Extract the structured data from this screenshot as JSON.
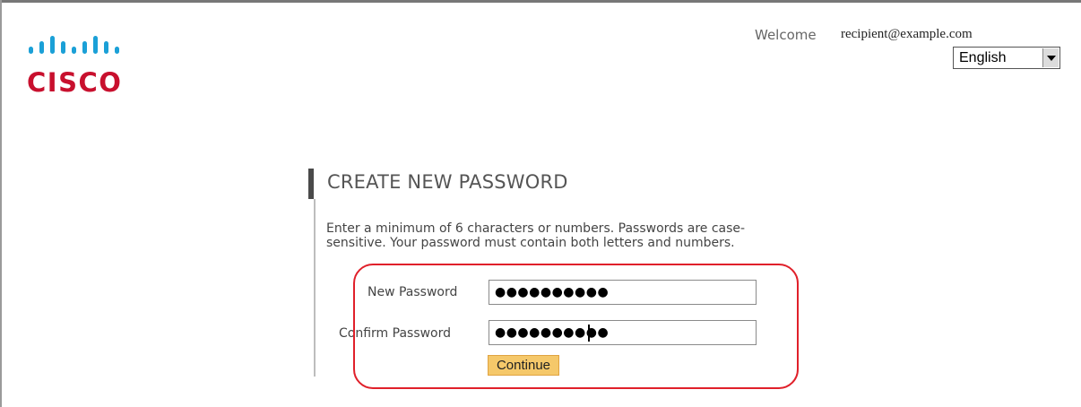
{
  "header": {
    "welcome_label": "Welcome",
    "user_email": "recipient@example.com",
    "language": {
      "selected": "English"
    },
    "logo": {
      "name": "cisco-logo",
      "text": "CISCO",
      "bar_color": "#1ba0d7",
      "text_color": "#c8102e"
    }
  },
  "form": {
    "title": "CREATE NEW PASSWORD",
    "instructions": "Enter a minimum of 6 characters or numbers. Passwords are case-sensitive. Your password must contain both letters and numbers.",
    "new_password": {
      "label": "New Password",
      "masked_value": "●●●●●●●●●●"
    },
    "confirm_password": {
      "label": "Confirm Password",
      "masked_value": "●●●●●●●●●●"
    },
    "continue_label": "Continue"
  },
  "annotation": {
    "highlight_color": "#e0202a"
  },
  "colors": {
    "button_bg": "#f5c86a",
    "title_text": "#555555"
  }
}
